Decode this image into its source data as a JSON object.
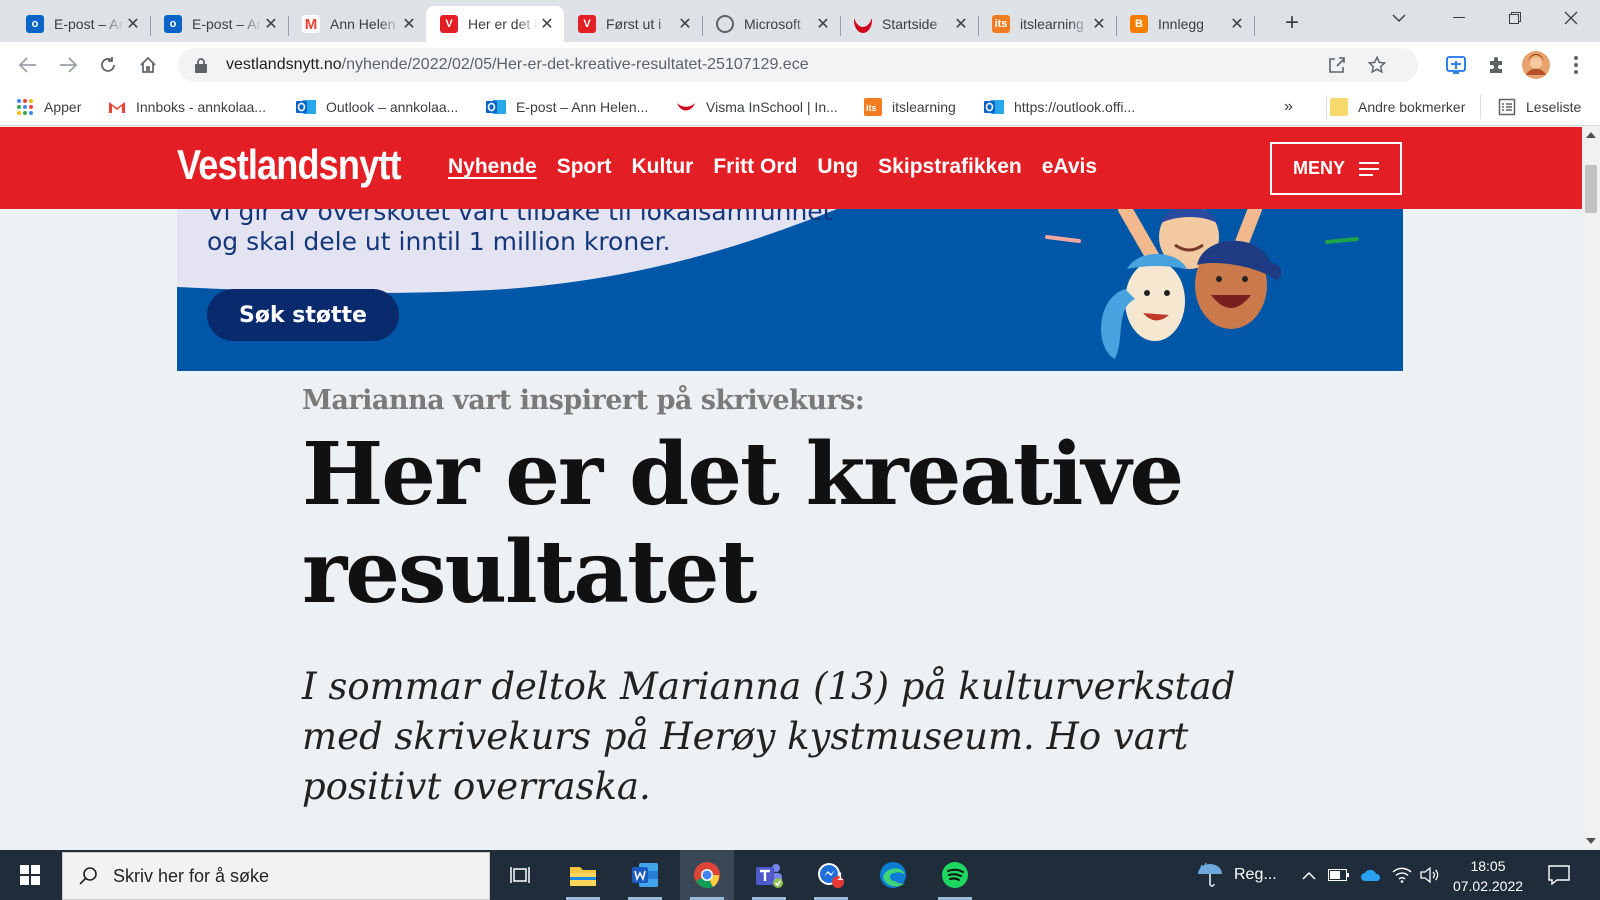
{
  "browser": {
    "tabs": [
      {
        "title": "E-post – Ann Helen Kolaas",
        "favicon": "outlook-icon",
        "fav_text": "o",
        "fav_color": "#0a64c8"
      },
      {
        "title": "E-post – Ann Helen Kolaas",
        "favicon": "outlook-icon",
        "fav_text": "o",
        "fav_color": "#0a64c8"
      },
      {
        "title": "Ann Helen Kolaas",
        "favicon": "gmail-icon",
        "fav_text": "M",
        "fav_color": "#ffffff"
      },
      {
        "title": "Her er det kreative",
        "favicon": "vestlandsnytt-icon",
        "fav_text": "V",
        "fav_color": "#e31e24"
      },
      {
        "title": "Først ut i",
        "favicon": "vestlandsnytt-icon",
        "fav_text": "V",
        "fav_color": "#e31e24"
      },
      {
        "title": "Microsoft",
        "favicon": "globe-icon",
        "fav_text": "",
        "fav_color": "#5f6368"
      },
      {
        "title": "Startside",
        "favicon": "visma-icon",
        "fav_text": "",
        "fav_color": "#d0021b"
      },
      {
        "title": "itslearning",
        "favicon": "itslearning-icon",
        "fav_text": "its",
        "fav_color": "#f47c20"
      },
      {
        "title": "Innlegg",
        "favicon": "blogger-icon",
        "fav_text": "B",
        "fav_color": "#f57d00"
      }
    ],
    "active_tab_index": 3,
    "url_host": "vestlandsnytt.no",
    "url_path": "/nyhende/2022/02/05/Her-er-det-kreative-resultatet-25107129.ece",
    "bookmarks": [
      {
        "label": "Apper",
        "icon": "apps-grid-icon"
      },
      {
        "label": "Innboks - annkolaa...",
        "icon": "gmail-icon"
      },
      {
        "label": "Outlook – annkolaa...",
        "icon": "outlook-icon"
      },
      {
        "label": "E-post – Ann Helen...",
        "icon": "outlook-icon"
      },
      {
        "label": "Visma InSchool | In...",
        "icon": "visma-icon"
      },
      {
        "label": "itslearning",
        "icon": "itslearning-icon"
      },
      {
        "label": "https://outlook.offi...",
        "icon": "outlook-icon"
      }
    ],
    "bookmarks_overflow": "»",
    "other_bookmarks": "Andre bokmerker",
    "reading_list": "Leseliste"
  },
  "site": {
    "logo": "Vestlandsnytt",
    "nav": [
      "Nyhende",
      "Sport",
      "Kultur",
      "Fritt Ord",
      "Ung",
      "Skipstrafikken",
      "eAvis"
    ],
    "nav_current_index": 0,
    "menu_label": "MENY",
    "brand_color": "#e31e24"
  },
  "ad": {
    "line1": "Vi gir av overskotet vårt tilbake til lokalsamfunnet",
    "line2": "og skal dele ut inntil 1 million kroner.",
    "button": "Søk støtte"
  },
  "article": {
    "kicker": "Marianna vart inspirert på skrivekurs:",
    "headline": "Her er det kreative resultatet",
    "lead": "I sommar deltok Marianna (13) på kulturverkstad med skrivekurs på Herøy kystmuseum. Ho vart positivt overraska."
  },
  "taskbar": {
    "search_placeholder": "Skriv her for å søke",
    "weather": "Reg...",
    "time": "18:05",
    "date": "07.02.2022",
    "messenger_badge": "1"
  }
}
